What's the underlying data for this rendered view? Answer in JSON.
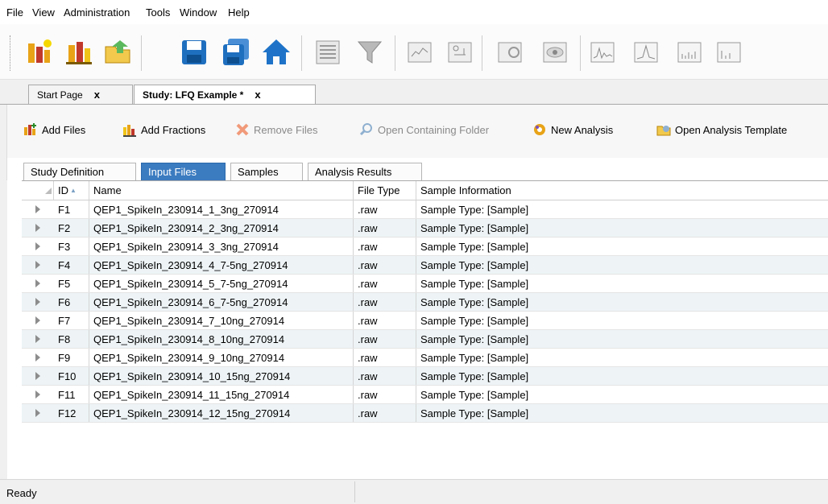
{
  "menu": [
    "File",
    "View",
    "Administration",
    "Tools",
    "Window",
    "Help"
  ],
  "toolbar": {
    "icons": [
      "new-study-icon",
      "new-analysis-icon",
      "open-study-icon",
      "save-icon",
      "save-all-icon",
      "home-icon",
      "table-view-icon",
      "filter-icon",
      "chart-view-icon",
      "structure-view-icon",
      "spectrum-preview-icon",
      "spectrum-viewer-icon",
      "chromatogram-icon",
      "peak-view-icon",
      "bar-chart-icon",
      "bar-chart-2-icon"
    ]
  },
  "doc_tabs": [
    {
      "title": "Start Page",
      "close": "x"
    },
    {
      "title": "Study: LFQ Example *",
      "close": "x"
    }
  ],
  "actions": {
    "add_files": "Add Files",
    "add_fractions": "Add Fractions",
    "remove_files": "Remove Files",
    "open_folder": "Open Containing Folder",
    "new_analysis": "New Analysis",
    "open_template": "Open Analysis Template"
  },
  "sub_tabs": [
    "Study Definition",
    "Input Files",
    "Samples",
    "Analysis Results"
  ],
  "selected_sub_tab": "Input Files",
  "table": {
    "columns": [
      "ID",
      "Name",
      "File Type",
      "Sample Information"
    ],
    "rows": [
      [
        "F1",
        "QEP1_SpikeIn_230914_1_3ng_270914",
        ".raw",
        "Sample Type: [Sample]"
      ],
      [
        "F2",
        "QEP1_SpikeIn_230914_2_3ng_270914",
        ".raw",
        "Sample Type: [Sample]"
      ],
      [
        "F3",
        "QEP1_SpikeIn_230914_3_3ng_270914",
        ".raw",
        "Sample Type: [Sample]"
      ],
      [
        "F4",
        "QEP1_SpikeIn_230914_4_7-5ng_270914",
        ".raw",
        "Sample Type: [Sample]"
      ],
      [
        "F5",
        "QEP1_SpikeIn_230914_5_7-5ng_270914",
        ".raw",
        "Sample Type: [Sample]"
      ],
      [
        "F6",
        "QEP1_SpikeIn_230914_6_7-5ng_270914",
        ".raw",
        "Sample Type: [Sample]"
      ],
      [
        "F7",
        "QEP1_SpikeIn_230914_7_10ng_270914",
        ".raw",
        "Sample Type: [Sample]"
      ],
      [
        "F8",
        "QEP1_SpikeIn_230914_8_10ng_270914",
        ".raw",
        "Sample Type: [Sample]"
      ],
      [
        "F9",
        "QEP1_SpikeIn_230914_9_10ng_270914",
        ".raw",
        "Sample Type: [Sample]"
      ],
      [
        "F10",
        "QEP1_SpikeIn_230914_10_15ng_270914",
        ".raw",
        "Sample Type: [Sample]"
      ],
      [
        "F11",
        "QEP1_SpikeIn_230914_11_15ng_270914",
        ".raw",
        "Sample Type: [Sample]"
      ],
      [
        "F12",
        "QEP1_SpikeIn_230914_12_15ng_270914",
        ".raw",
        "Sample Type: [Sample]"
      ]
    ]
  },
  "status": "Ready",
  "colors": {
    "selected_tab": "#3b7bc0",
    "alt_row": "#eef4f6",
    "home_icon": "#1e73c8"
  }
}
